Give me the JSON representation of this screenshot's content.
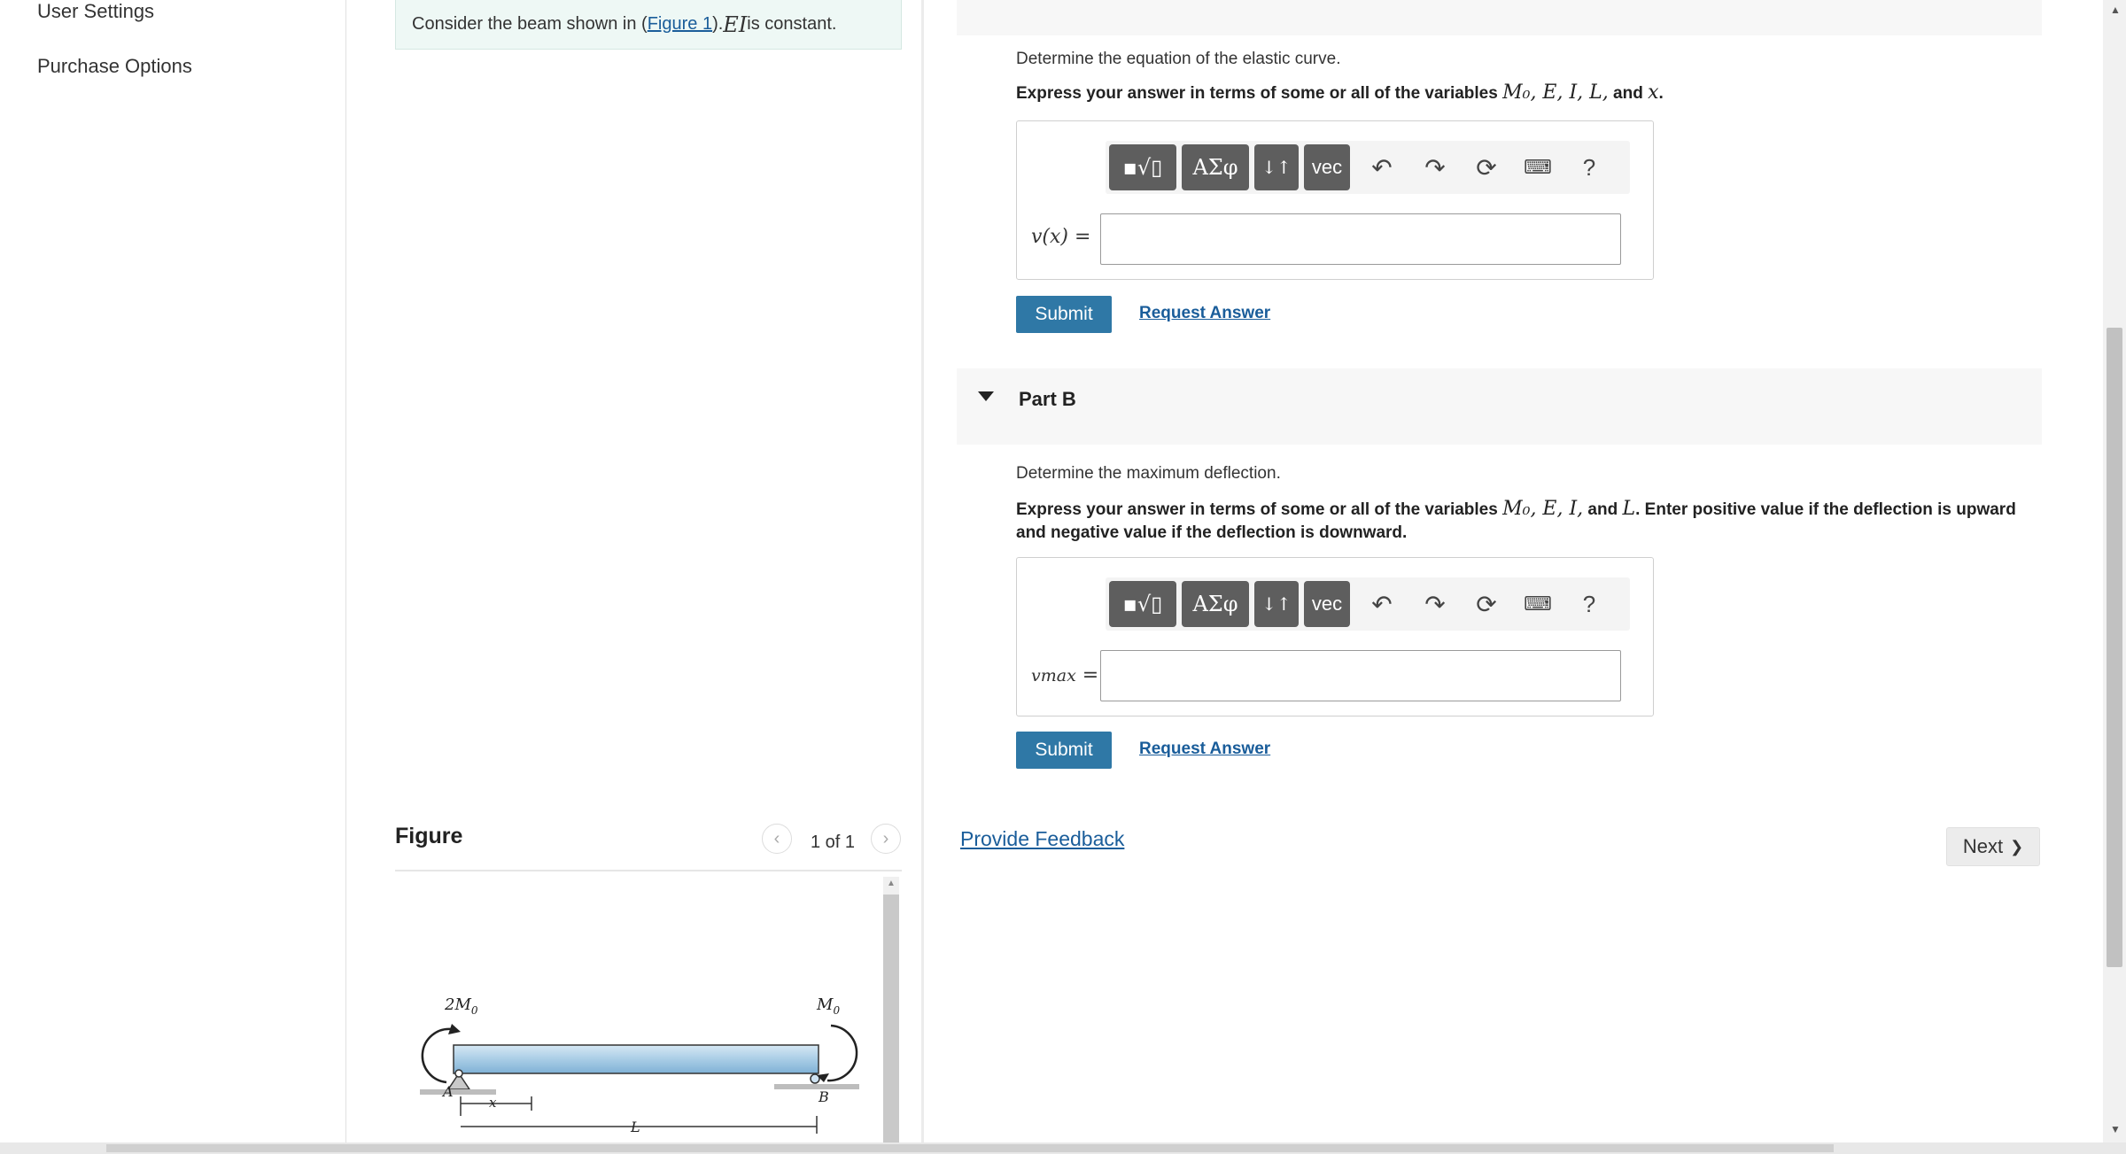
{
  "nav": {
    "items": [
      {
        "label": "User Settings"
      },
      {
        "label": "Purchase Options"
      }
    ]
  },
  "problem": {
    "text_before": "Consider the beam shown in (",
    "figure_link": "Figure 1",
    "text_after": "). ",
    "ei": "EI",
    "text_end": " is constant."
  },
  "figure": {
    "title": "Figure",
    "page": "1 of 1",
    "labels": {
      "left_moment": "2M",
      "left_moment_sub": "0",
      "right_moment": "M",
      "right_moment_sub": "0",
      "a": "A",
      "b": "B",
      "x": "x",
      "l": "L"
    }
  },
  "part_a": {
    "prompt": "Determine the equation of the elastic curve.",
    "instruction_prefix": "Express your answer in terms of some or all of the variables ",
    "instruction_vars": "M₀, E, I, L,",
    "instruction_and": " and ",
    "instruction_last": "x",
    "instruction_end": ".",
    "variable_label": "v(x) =",
    "submit_label": "Submit",
    "request_label": "Request Answer"
  },
  "part_b": {
    "label": "Part B",
    "prompt": "Determine the maximum deflection.",
    "instruction_prefix": "Express your answer in terms of some or all of the variables ",
    "instruction_vars": "M₀, E, I,",
    "instruction_and": " and ",
    "instruction_last": "L",
    "instruction_end": ". Enter positive value if the deflection is upward and negative value if the deflection is downward.",
    "variable_label": "vmax",
    "variable_eq": " =",
    "submit_label": "Submit",
    "request_label": "Request Answer"
  },
  "toolbar": {
    "templates": "▪√▯",
    "greek": "ΑΣφ",
    "arrows": "↓↑",
    "vec": "vec",
    "help": "?"
  },
  "footer": {
    "feedback_label": "Provide Feedback",
    "next_label": "Next",
    "next_chevron": "❯"
  },
  "icons": {
    "undo": "undo-icon",
    "redo": "redo-icon",
    "reset": "reset-icon",
    "keyboard": "keyboard-icon"
  }
}
